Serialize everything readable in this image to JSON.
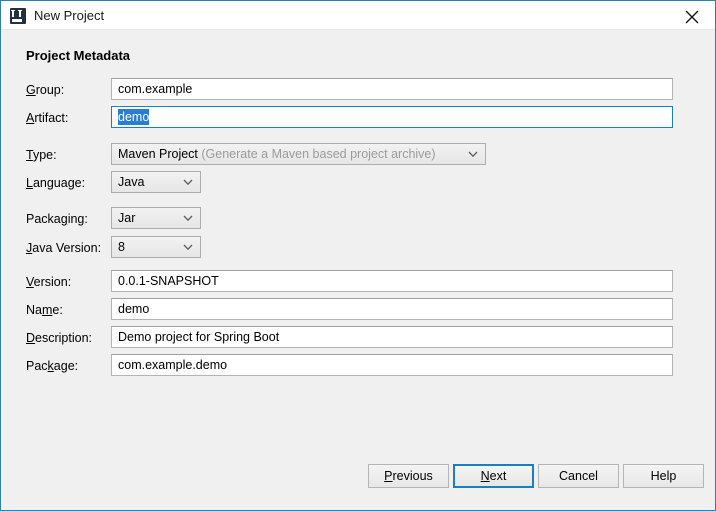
{
  "window": {
    "title": "New Project",
    "icon": "intellij-idea-icon",
    "close_label": "✕",
    "accent_color": "#1a7fc1",
    "background": "#f0f0f0",
    "titlebar_background": "#ffffff"
  },
  "section": {
    "heading": "Project Metadata"
  },
  "fields": {
    "group": {
      "label_pre": "",
      "label_mn": "G",
      "label_post": "roup:",
      "value": "com.example",
      "type": "text"
    },
    "artifact": {
      "label_pre": "",
      "label_mn": "A",
      "label_post": "rtifact:",
      "value": "demo",
      "type": "text",
      "focused": true,
      "selected": true
    },
    "type": {
      "label_pre": "",
      "label_mn": "T",
      "label_post": "ype:",
      "value": "Maven Project",
      "hint": "(Generate a Maven based project archive)",
      "type": "combo"
    },
    "language": {
      "label_pre": "",
      "label_mn": "L",
      "label_post": "anguage:",
      "value": "Java",
      "type": "combo"
    },
    "packaging": {
      "label_pre": "Packa",
      "label_mn": "g",
      "label_post": "ing:",
      "value": "Jar",
      "type": "combo"
    },
    "java_version": {
      "label_pre": "",
      "label_mn": "J",
      "label_post": "ava Version:",
      "value": "8",
      "type": "combo"
    },
    "version": {
      "label_pre": "",
      "label_mn": "V",
      "label_post": "ersion:",
      "value": "0.0.1-SNAPSHOT",
      "type": "text"
    },
    "name": {
      "label_pre": "Na",
      "label_mn": "m",
      "label_post": "e:",
      "value": "demo",
      "type": "text"
    },
    "description": {
      "label_pre": "",
      "label_mn": "D",
      "label_post": "escription:",
      "value": "Demo project for Spring Boot",
      "type": "text"
    },
    "package": {
      "label_pre": "Pac",
      "label_mn": "k",
      "label_post": "age:",
      "value": "com.example.demo",
      "type": "text"
    }
  },
  "buttons": {
    "previous": {
      "pre": "",
      "mn": "P",
      "post": "revious"
    },
    "next": {
      "pre": "",
      "mn": "N",
      "post": "ext",
      "default": true
    },
    "cancel": {
      "pre": "Cancel",
      "mn": "",
      "post": ""
    },
    "help": {
      "pre": "Help",
      "mn": "",
      "post": ""
    }
  }
}
